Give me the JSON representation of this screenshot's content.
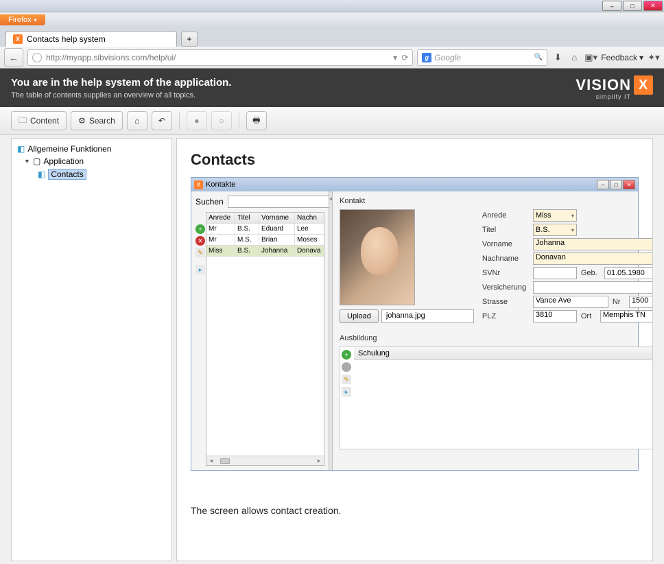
{
  "os": {
    "minimize": "–",
    "maximize": "□",
    "close": "✕"
  },
  "browser": {
    "name": "Firefox",
    "tab_title": "Contacts help system",
    "url": "http://myapp.sibvisions.com/help/ui/",
    "search_placeholder": "Google",
    "feedback": "Feedback"
  },
  "header": {
    "title": "You are in the help system of the application.",
    "sub": "The table of contents supplies an overview of all topics.",
    "logo": "VISION",
    "logo_sub": "simplify IT"
  },
  "toolbar": {
    "content": "Content",
    "search": "Search"
  },
  "tree": {
    "root": "Allgemeine Funktionen",
    "app": "Application",
    "contacts": "Contacts"
  },
  "page": {
    "title": "Contacts",
    "desc": "The screen allows contact creation."
  },
  "win": {
    "title": "Kontakte",
    "suchen": "Suchen",
    "cols": {
      "anrede": "Anrede",
      "titel": "Titel",
      "vorname": "Vorname",
      "nachname": "Nachn"
    },
    "rows": [
      {
        "an": "Mr",
        "ti": "B.S.",
        "vn": "Eduard",
        "nn": "Lee"
      },
      {
        "an": "Mr",
        "ti": "M.S.",
        "vn": "Brian",
        "nn": "Moses"
      },
      {
        "an": "Miss",
        "ti": "B.S.",
        "vn": "Johanna",
        "nn": "Donava"
      }
    ],
    "kontakt": "Kontakt",
    "labels": {
      "anrede": "Anrede",
      "titel": "Titel",
      "vorname": "Vorname",
      "nachname": "Nachname",
      "svnr": "SVNr",
      "geb": "Geb.",
      "versicherung": "Versicherung",
      "strasse": "Strasse",
      "nr": "Nr",
      "plz": "PLZ",
      "ort": "Ort"
    },
    "vals": {
      "anrede": "Miss",
      "titel": "B.S.",
      "vorname": "Johanna",
      "nachname": "Donavan",
      "svnr": "",
      "geb": "01.05.1980",
      "versicherung": "",
      "strasse": "Vance Ave",
      "nr": "1500",
      "plz": "3810",
      "ort": "Memphis TN"
    },
    "upload": "Upload",
    "filename": "johanna.jpg",
    "ausbildung": "Ausbildung",
    "schulung": "Schulung"
  }
}
